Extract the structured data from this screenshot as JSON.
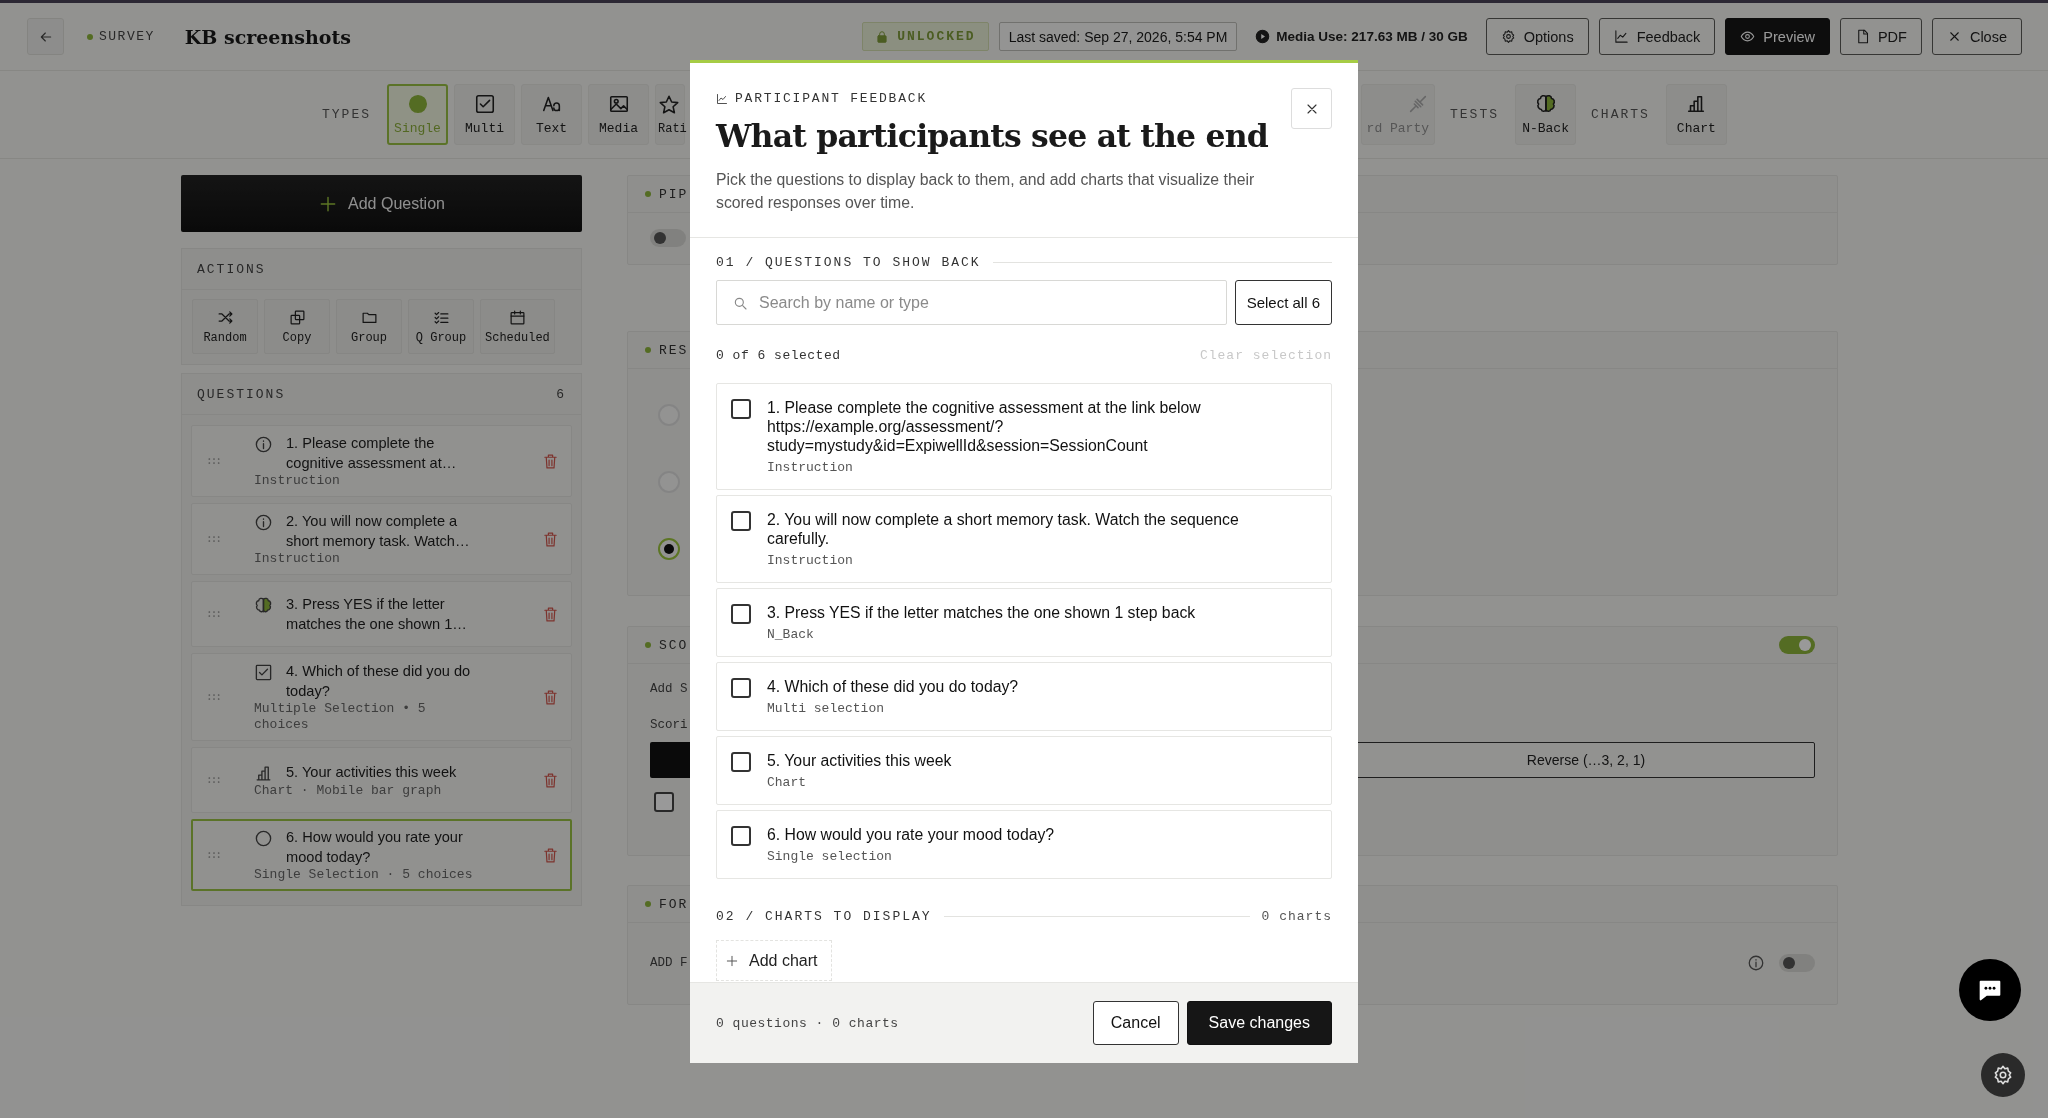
{
  "topbar": {
    "section": "SURVEY",
    "title": "KB screenshots",
    "lock_badge": "UNLOCKED",
    "last_saved": "Last saved: Sep 27, 2026, 5:54 PM",
    "media_use": "Media Use: 217.63 MB / 30 GB",
    "buttons": [
      {
        "label": "Options",
        "kind": "settings",
        "primary": false
      },
      {
        "label": "Feedback",
        "kind": "feedback",
        "primary": false
      },
      {
        "label": "Preview",
        "kind": "preview",
        "primary": true
      },
      {
        "label": "PDF",
        "kind": "pdf",
        "primary": false
      },
      {
        "label": "Close",
        "kind": "close",
        "primary": false
      }
    ]
  },
  "toolbar": {
    "groups": [
      {
        "label": "TYPES",
        "tiles": [
          {
            "label": "Single",
            "kind": "single",
            "selected": true,
            "disabled": false
          },
          {
            "label": "Multi",
            "kind": "multi",
            "selected": false,
            "disabled": false
          },
          {
            "label": "Text",
            "kind": "text",
            "selected": false,
            "disabled": false
          },
          {
            "label": "Media",
            "kind": "media",
            "selected": false,
            "disabled": false
          },
          {
            "label": "Rati",
            "kind": "rating",
            "selected": false,
            "disabled": false
          }
        ]
      },
      {
        "tiles": [
          {
            "label": "rd Party",
            "kind": "plug",
            "selected": false,
            "disabled": true
          }
        ]
      },
      {
        "label": "TESTS",
        "tiles": [
          {
            "label": "N-Back",
            "kind": "brain",
            "selected": false,
            "disabled": false
          }
        ]
      },
      {
        "label": "CHARTS",
        "tiles": [
          {
            "label": "Chart",
            "kind": "chart",
            "selected": false,
            "disabled": false
          }
        ]
      }
    ]
  },
  "sidebar": {
    "add_question": "Add Question",
    "actions": {
      "title": "ACTIONS",
      "buttons": [
        {
          "label": "Random",
          "kind": "shuffle"
        },
        {
          "label": "Copy",
          "kind": "copy"
        },
        {
          "label": "Group",
          "kind": "folder"
        },
        {
          "label": "Q Group",
          "kind": "list"
        },
        {
          "label": "Scheduled",
          "kind": "calendar"
        }
      ]
    },
    "questions": {
      "title": "QUESTIONS",
      "count": "6",
      "items": [
        {
          "title": "1. Please complete the cognitive assessment at…",
          "type": "Instruction",
          "kind": "info",
          "selected": false
        },
        {
          "title": "2. You will now complete a short memory task. Watch…",
          "type": "Instruction",
          "kind": "info",
          "selected": false
        },
        {
          "title": "3. Press YES if the letter matches the one shown 1…",
          "kind": "brain",
          "selected": false
        },
        {
          "title": "4. Which of these did you do today?",
          "type": "Multiple Selection • 5 choices",
          "kind": "checkbox",
          "selected": false
        },
        {
          "title": "5. Your activities this week",
          "type": "Chart · Mobile bar graph",
          "kind": "chart",
          "selected": false
        },
        {
          "title": "6. How would you rate your mood today?",
          "type": "Single Selection · 5 choices",
          "kind": "radio",
          "selected": true
        }
      ]
    }
  },
  "panels": [
    {
      "kind": "piping",
      "title": "PIP",
      "toggle_on": false
    },
    {
      "kind": "responses",
      "title": "RES",
      "options": [
        {
          "selected": false
        },
        {
          "selected": false
        },
        {
          "selected": true
        }
      ]
    },
    {
      "kind": "scoring",
      "title": "SCO",
      "toggle_on": true,
      "add_label": "Add S",
      "scoring_label": "Scori",
      "order_button": "Reverse (…3, 2, 1)",
      "checkbox_checked": false
    },
    {
      "kind": "form",
      "title": "FOR",
      "add_label": "ADD F",
      "toggle_on": false
    }
  ],
  "modal": {
    "eyebrow": "PARTICIPANT FEEDBACK",
    "title": "What participants see at the end",
    "description": "Pick the questions to display back to them, and add charts that visualize their scored responses over time.",
    "section1": "01 / QUESTIONS TO SHOW BACK",
    "search": {
      "placeholder": "Search by name or type"
    },
    "select_all": "Select all 6",
    "selected_count": "0 of 6 selected",
    "clear": "Clear selection",
    "clear_disabled": true,
    "questions": [
      {
        "title": "1. Please complete the cognitive assessment at the link below https://example.org/assessment/?study=mystudy&id=ExpiwellId&session=SessionCount",
        "type": "Instruction",
        "checked": false
      },
      {
        "title": "2. You will now complete a short memory task. Watch the sequence carefully.",
        "type": "Instruction",
        "checked": false
      },
      {
        "title": "3. Press YES if the letter matches the one shown 1 step back",
        "type": "N_Back",
        "checked": false
      },
      {
        "title": "4. Which of these did you do today?",
        "type": "Multi selection",
        "checked": false
      },
      {
        "title": "5. Your activities this week",
        "type": "Chart",
        "checked": false
      },
      {
        "title": "6. How would you rate your mood today?",
        "type": "Single selection",
        "checked": false
      }
    ],
    "section2": "02 / CHARTS TO DISPLAY",
    "chart_count": "0 charts",
    "add_chart": "Add chart",
    "footer": {
      "summary": "0 questions · 0 charts",
      "cancel": "Cancel",
      "save": "Save changes"
    }
  }
}
